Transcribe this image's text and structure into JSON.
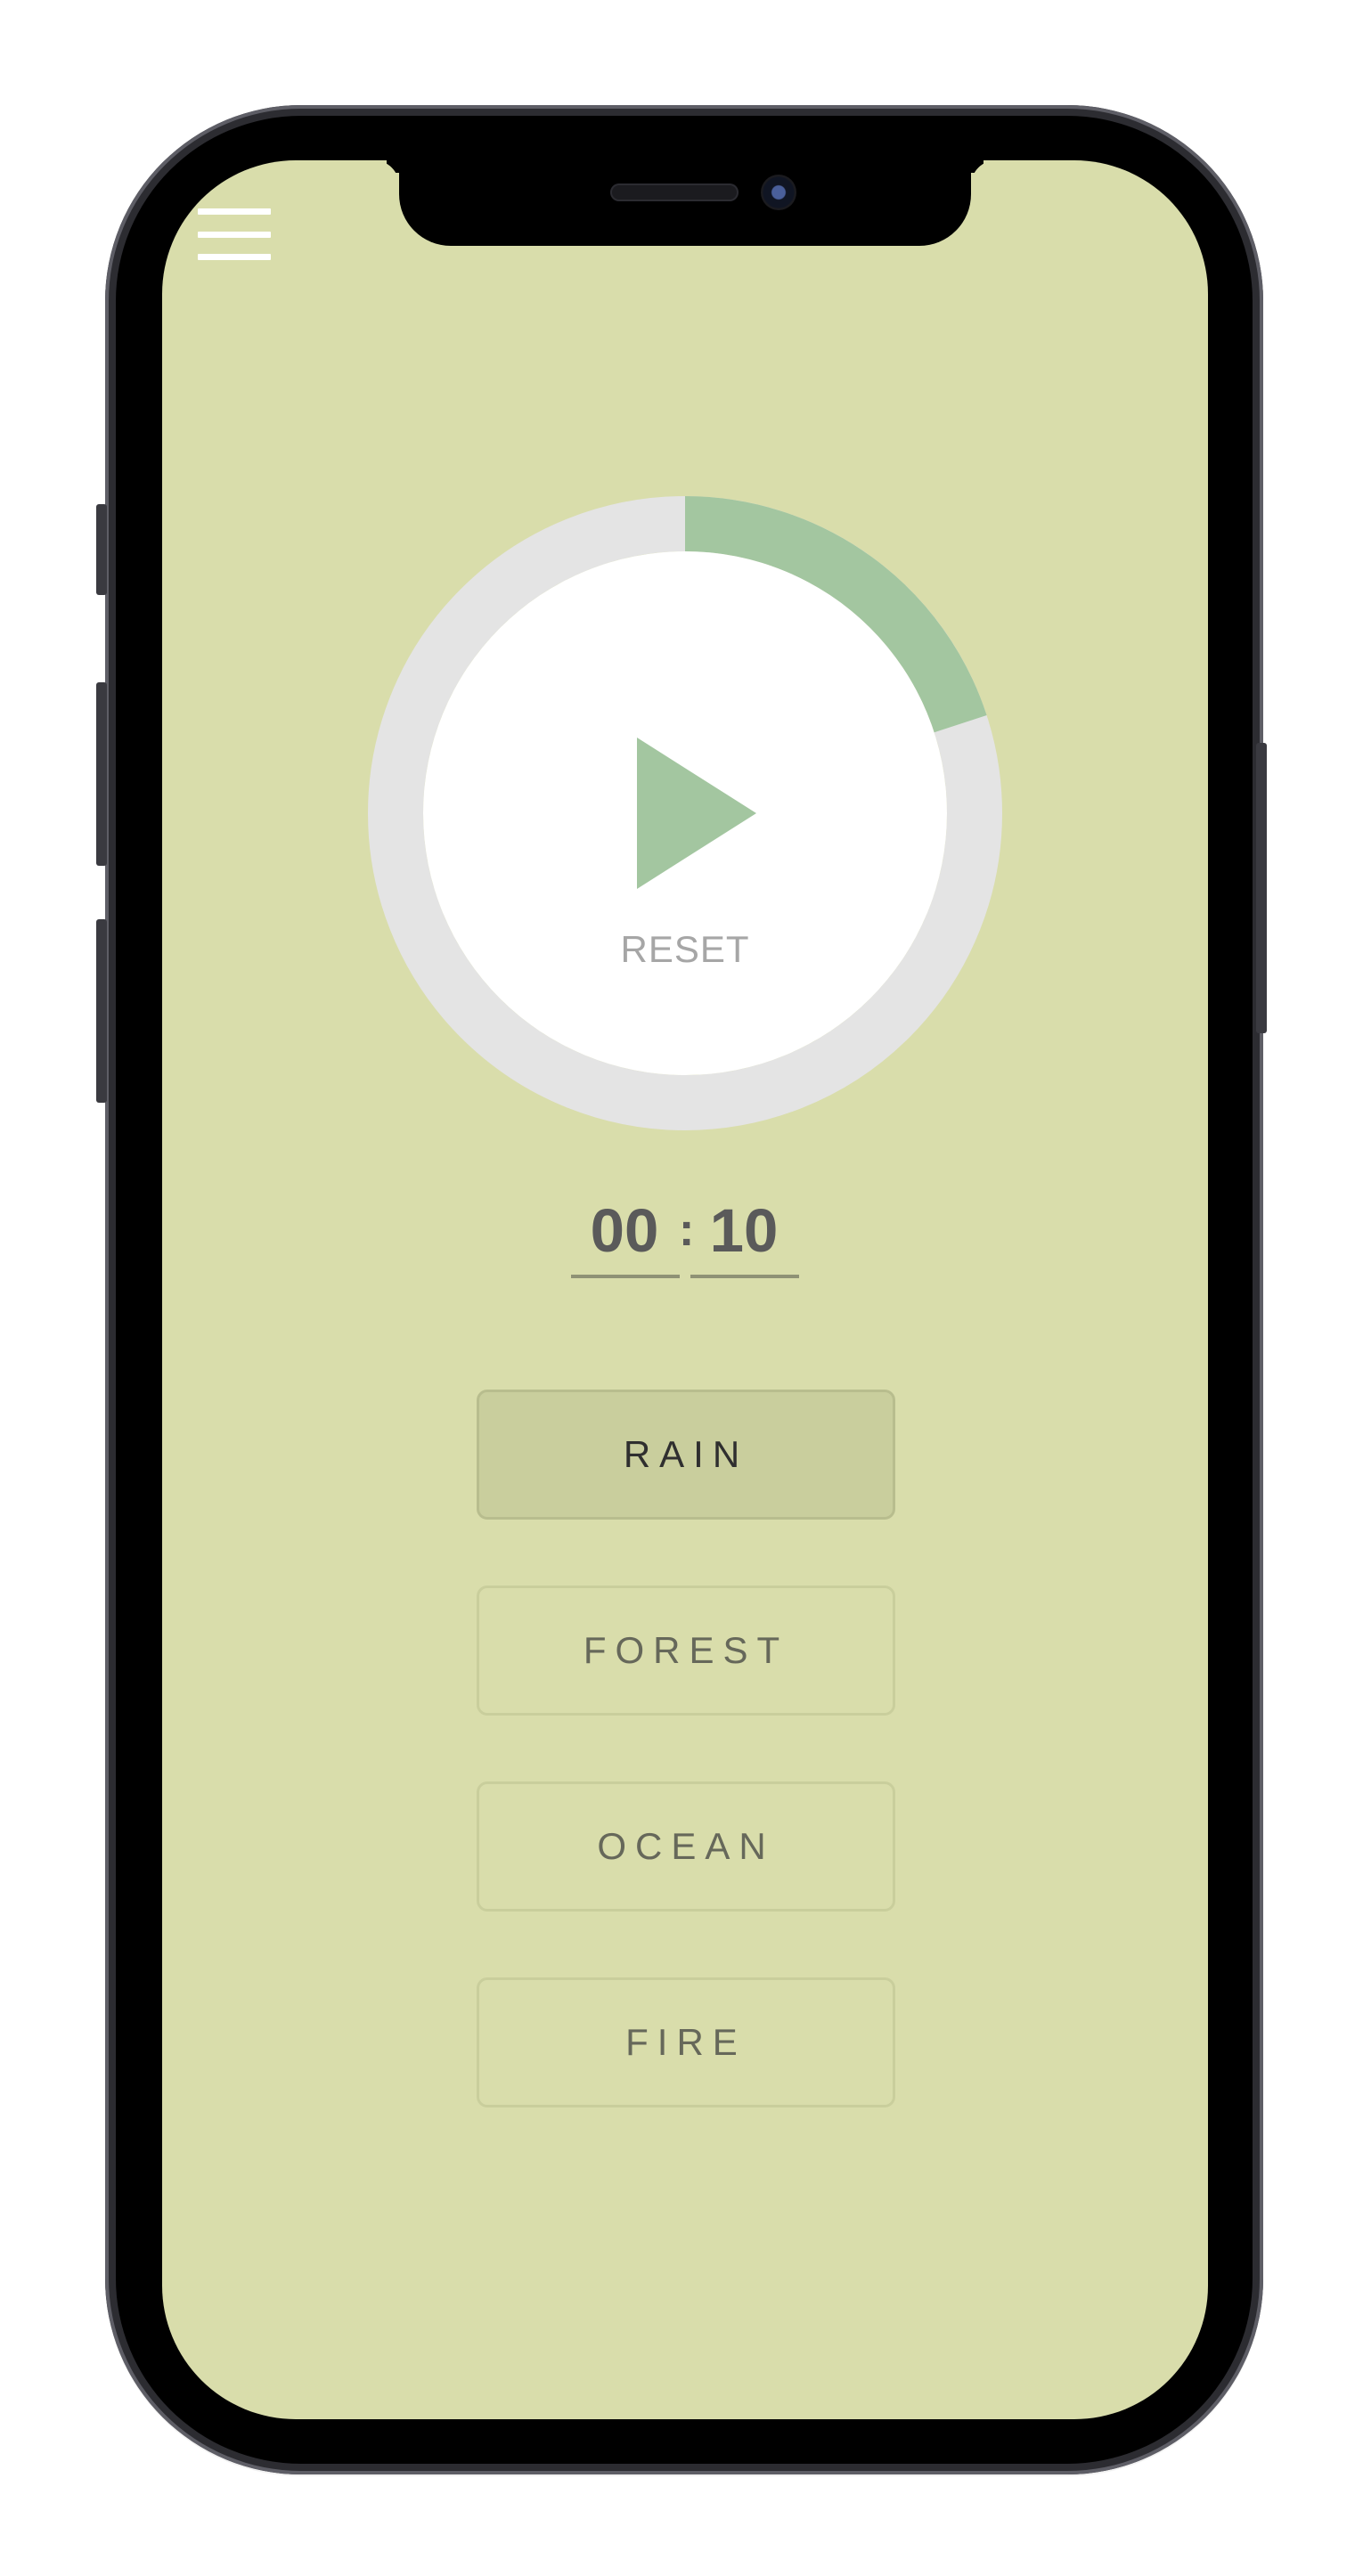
{
  "screen": {
    "background_color": "#d9ddab"
  },
  "header": {
    "menu_icon": "hamburger-menu-icon"
  },
  "timer": {
    "progress_fraction": 0.2,
    "progress_color": "#a3c6a0",
    "track_color": "#e4e4e4",
    "play_icon": "play-icon",
    "reset_label": "RESET"
  },
  "time": {
    "minutes": "00",
    "separator": ":",
    "seconds": "10"
  },
  "sounds": {
    "items": [
      {
        "label": "RAIN",
        "active": true
      },
      {
        "label": "FOREST",
        "active": false
      },
      {
        "label": "OCEAN",
        "active": false
      },
      {
        "label": "FIRE",
        "active": false
      }
    ]
  }
}
